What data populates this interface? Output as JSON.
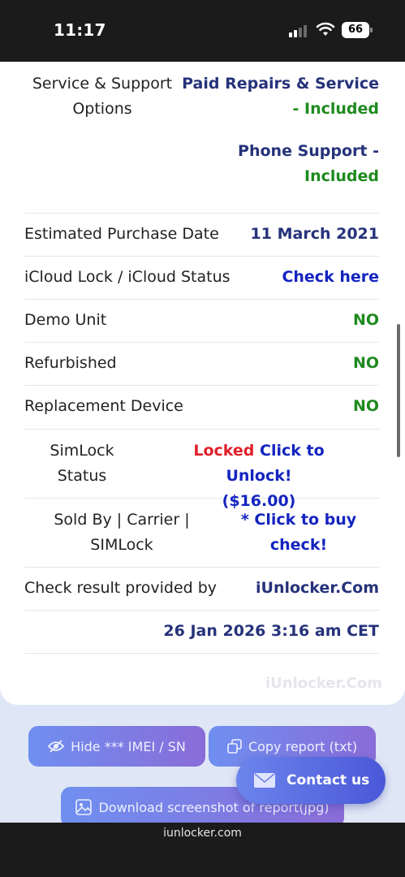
{
  "status_bar": {
    "time": "11:17",
    "battery": "66"
  },
  "rows": {
    "service": {
      "label_line1": "Service & Support",
      "label_line2": "Options",
      "paid_line1": "Paid Repairs & Service",
      "paid_line2": "- Included",
      "phone_line1": "Phone Support -",
      "phone_line2": "Included"
    },
    "purchase": {
      "label": "Estimated Purchase Date",
      "value": "11 March 2021"
    },
    "icloud": {
      "label": "iCloud Lock / iCloud Status",
      "value": "Check here"
    },
    "demo": {
      "label": "Demo Unit",
      "value": "NO"
    },
    "refurbished": {
      "label": "Refurbished",
      "value": "NO"
    },
    "replacement": {
      "label": "Replacement Device",
      "value": "NO"
    },
    "simlock": {
      "label_line1": "SimLock",
      "label_line2": "Status",
      "locked": "Locked",
      "unlock_line1": "Click to Unlock!",
      "unlock_line2": "($16.00)"
    },
    "sold_by": {
      "label_line1": "Sold By | Carrier |",
      "label_line2": "SIMLock",
      "value_line1": "* Click to buy",
      "value_line2": "check!"
    },
    "provider": {
      "label": "Check result provided by",
      "value": "iUnlocker.Com"
    },
    "date": {
      "value": "26 Jan 2026 3:16 am CET"
    }
  },
  "watermark": "iUnlocker.Com",
  "buttons": {
    "hide": "Hide *** IMEI / SN",
    "copy": "Copy report (txt)",
    "download": "Download screenshot of report(jpg)",
    "contact": "Contact us"
  },
  "browser": {
    "url": "iunlocker.com"
  },
  "colors": {
    "navy": "#26327a",
    "green": "#1e8a1e",
    "blue": "#1424c0",
    "red": "#e0202a",
    "button_gradient_start": "#6f8ff0",
    "button_gradient_end": "#8a6cd8"
  }
}
